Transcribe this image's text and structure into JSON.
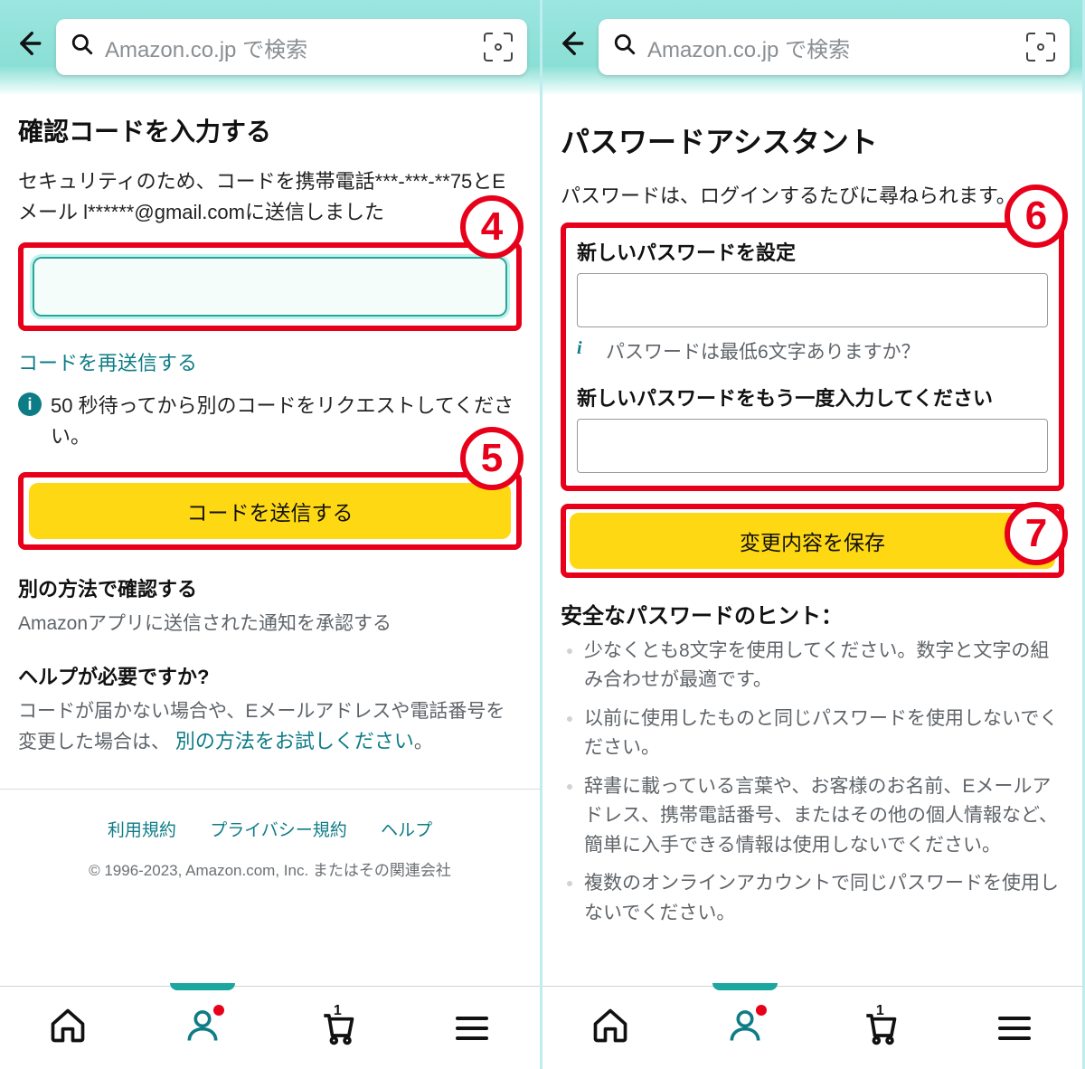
{
  "annotations": {
    "badge4": "4",
    "badge5": "5",
    "badge6": "6",
    "badge7": "7"
  },
  "search": {
    "placeholder": "Amazon.co.jp で検索"
  },
  "nav": {
    "cart_count": "1"
  },
  "left": {
    "title": "確認コードを入力する",
    "desc": "セキュリティのため、コードを携帯電話***-***-**75とEメール l******@gmail.comに送信しました",
    "resend_link": "コードを再送信する",
    "wait_info": "50 秒待ってから別のコードをリクエストしてください。",
    "submit_button": "コードを送信する",
    "alt_header": "別の方法で確認する",
    "alt_text": "Amazonアプリに送信された通知を承認する",
    "help_header": "ヘルプが必要ですか?",
    "help_text_pre": "コードが届かない場合や、Eメールアドレスや電話番号を変更した場合は、",
    "help_link": "別の方法をお試しください",
    "help_text_post": "。",
    "footer": {
      "terms": "利用規約",
      "privacy": "プライバシー規約",
      "help": "ヘルプ",
      "copyright": "© 1996-2023, Amazon.com, Inc. またはその関連会社"
    }
  },
  "right": {
    "title": "パスワードアシスタント",
    "desc": "パスワードは、ログインするたびに尋ねられます。",
    "new_pw_label": "新しいパスワードを設定",
    "pw_hint": "パスワードは最低6文字ありますか？",
    "confirm_label": "新しいパスワードをもう一度入力してください",
    "save_button": "変更内容を保存",
    "tips_header": "安全なパスワードのヒント：",
    "tips": [
      "少なくとも8文字を使用してください。数字と文字の組み合わせが最適です。",
      "以前に使用したものと同じパスワードを使用しないでください。",
      "辞書に載っている言葉や、お客様のお名前、Eメールアドレス、携帯電話番号、またはその他の個人情報など、簡単に入手できる情報は使用しないでください。",
      "複数のオンラインアカウントで同じパスワードを使用しないでください。"
    ]
  }
}
